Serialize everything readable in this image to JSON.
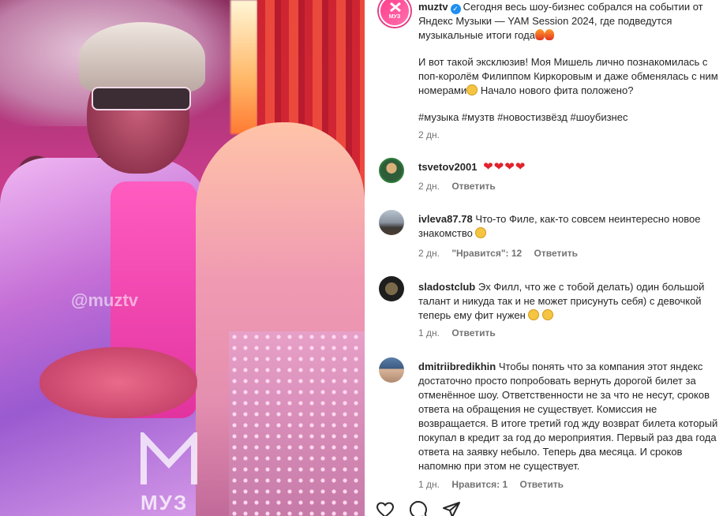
{
  "photo": {
    "watermark": "@muztv",
    "logo_text": "МУЗ"
  },
  "post": {
    "username": "muztv",
    "avatar_label": "МУЗ",
    "caption_line1": "Сегодня весь шоу-бизнес собрался на событии от Яндекс Музыки — YAM Session 2024, где подведутся музыкальные итоги года",
    "caption_para2": "И вот такой эксклюзив! Моя Мишель лично познакомилась с поп-королём Филиппом Киркоровым и даже обменялась с ним номерами",
    "caption_para2_end": " Начало нового фита положено?",
    "hashtags": "#музыка #музтв #новостизвёзд #шоубизнес",
    "time": "2 дн."
  },
  "comments": [
    {
      "username": "tsvetov2001",
      "text": "",
      "hearts": "❤❤❤❤",
      "time": "2 дн.",
      "reply": "Ответить"
    },
    {
      "username": "ivleva87.78",
      "text": "Что-то Филе, как-то совсем неинтересно новое знакомство",
      "time": "2 дн.",
      "likes": "\"Нравится\": 12",
      "reply": "Ответить"
    },
    {
      "username": "sladostclub",
      "text": "Эх Филл, что же с тобой делать) один большой талант и никуда так и не может присунуть себя) с девочкой теперь ему фит нужен",
      "time": "1 дн.",
      "reply": "Ответить"
    },
    {
      "username": "dmitriibredikhin",
      "text": "Чтобы понять что за компания этот яндекс достаточно просто попробовать вернуть дорогой билет за отменённое шоу. Ответственности не за что не несут, сроков ответа на обращения не существует. Комиссия не возвращается. В итоге третий год жду возврат билета который покупал в кредит за год до мероприятия. Первый раз два года ответа на заявку небыло. Теперь два месяца. И сроков напомню при этом не существует.",
      "time": "1 дн.",
      "likes": "Нравится: 1",
      "reply": "Ответить"
    }
  ],
  "icons": [
    "heart-outline-icon",
    "comment-icon",
    "share-icon"
  ]
}
